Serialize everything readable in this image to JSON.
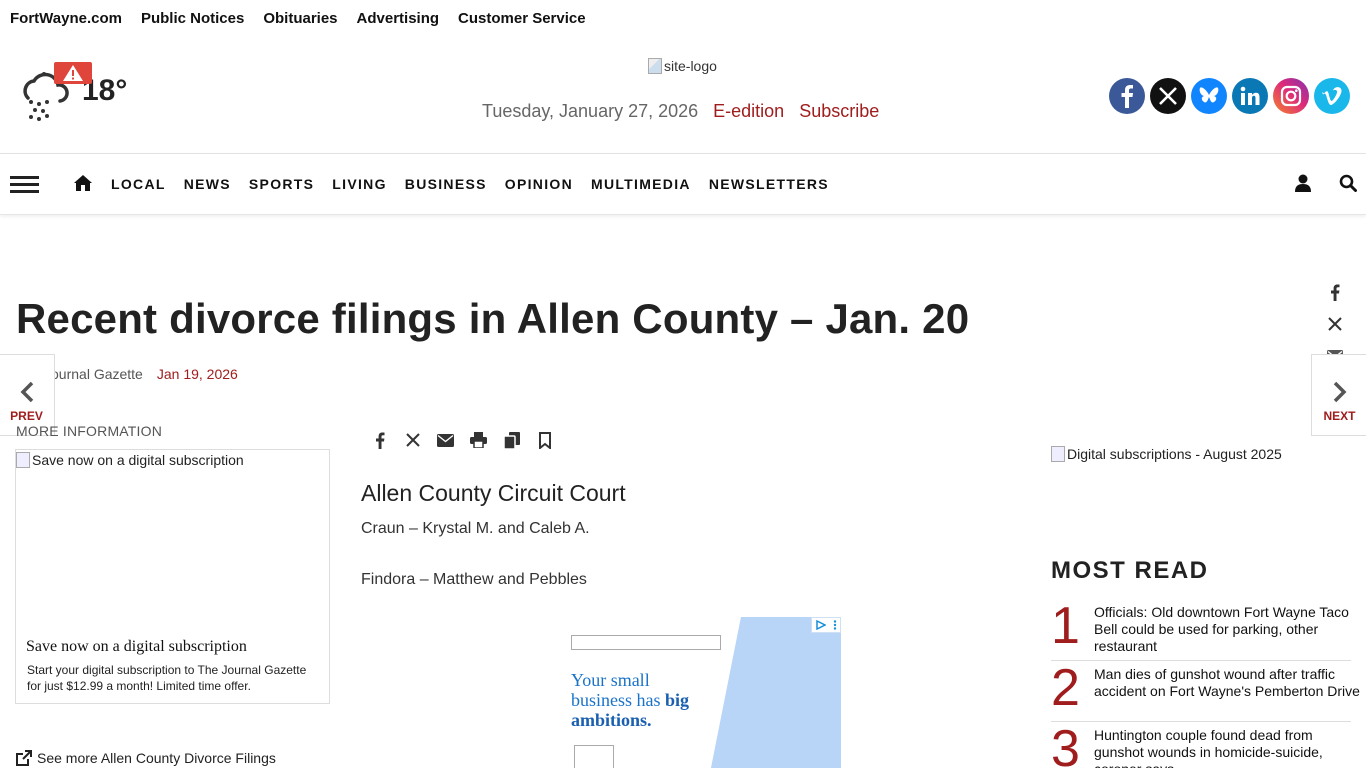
{
  "topbar": {
    "links": [
      "FortWayne.com",
      "Public Notices",
      "Obituaries",
      "Advertising",
      "Customer Service"
    ]
  },
  "weather": {
    "temperature": "18°",
    "icon": "snow-cloud-icon",
    "alert_icon": "warning-icon"
  },
  "masthead": {
    "logo_alt": "site-logo",
    "date": "Tuesday, January 27, 2026",
    "eedition": "E-edition",
    "subscribe": "Subscribe",
    "accent_color": "#a01d1d"
  },
  "social": [
    {
      "name": "facebook",
      "color": "#3b5998"
    },
    {
      "name": "x",
      "color": "#111111"
    },
    {
      "name": "bluesky",
      "color": "#1185fe"
    },
    {
      "name": "linkedin",
      "color": "#0a78b5"
    },
    {
      "name": "instagram",
      "color": "#c13584"
    },
    {
      "name": "vimeo",
      "color": "#1ab7ea"
    }
  ],
  "nav": {
    "items": [
      "LOCAL",
      "NEWS",
      "SPORTS",
      "LIVING",
      "BUSINESS",
      "OPINION",
      "MULTIMEDIA",
      "NEWSLETTERS"
    ]
  },
  "article": {
    "title": "Recent divorce filings in Allen County – Jan. 20",
    "author": "The Journal Gazette",
    "date": "Jan 19, 2026",
    "court": "Allen County Circuit Court",
    "paragraphs": [
      "Craun – Krystal M. and Caleb A.",
      "Findora – Matthew and Pebbles"
    ]
  },
  "pager": {
    "prev": "PREV",
    "next": "NEXT"
  },
  "left_column": {
    "more_info": "MORE INFORMATION",
    "promo_image_alt": "Save now on a digital subscription",
    "promo_title": "Save now on a digital subscription",
    "promo_body": "Start your digital subscription to The Journal Gazette for just $12.99 a month! Limited time offer.",
    "see_more": "See more Allen County Divorce Filings"
  },
  "ad": {
    "line1": "Your small",
    "line2a": "business has ",
    "line2b": "big",
    "line3": "ambitions."
  },
  "right_rail": {
    "image_alt": "Digital subscriptions - August 2025",
    "most_read_heading": "MOST READ",
    "most_read": [
      {
        "rank": "1",
        "title": "Officials: Old downtown Fort Wayne Taco Bell could be used for parking, other restaurant"
      },
      {
        "rank": "2",
        "title": "Man dies of gunshot wound after traffic accident on Fort Wayne's Pemberton Drive"
      },
      {
        "rank": "3",
        "title": "Huntington couple found dead from gunshot wounds in homicide-suicide, coroner says"
      }
    ]
  }
}
